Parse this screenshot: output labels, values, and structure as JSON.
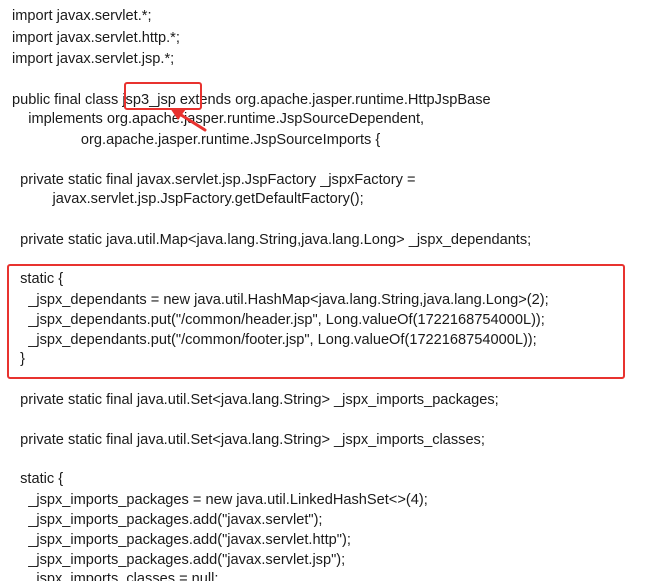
{
  "code_lines": [
    "import javax.servlet.*;",
    "import javax.servlet.http.*;",
    "import javax.servlet.jsp.*;",
    "public final class jsp3_jsp extends org.apache.jasper.runtime.HttpJspBase",
    "    implements org.apache.jasper.runtime.JspSourceDependent,",
    "                 org.apache.jasper.runtime.JspSourceImports {",
    "  private static final javax.servlet.jsp.JspFactory _jspxFactory =",
    "          javax.servlet.jsp.JspFactory.getDefaultFactory();",
    "  private static java.util.Map<java.lang.String,java.lang.Long> _jspx_dependants;",
    "  static {",
    "    _jspx_dependants = new java.util.HashMap<java.lang.String,java.lang.Long>(2);",
    "    _jspx_dependants.put(\"/common/header.jsp\", Long.valueOf(1722168754000L));",
    "    _jspx_dependants.put(\"/common/footer.jsp\", Long.valueOf(1722168754000L));",
    "  }",
    "  private static final java.util.Set<java.lang.String> _jspx_imports_packages;",
    "  private static final java.util.Set<java.lang.String> _jspx_imports_classes;",
    "  static {",
    "    _jspx_imports_packages = new java.util.LinkedHashSet<>(4);",
    "    _jspx_imports_packages.add(\"javax.servlet\");",
    "    _jspx_imports_packages.add(\"javax.servlet.http\");",
    "    _jspx_imports_packages.add(\"javax.servlet.jsp\");",
    "    _jspx_imports_classes = null;"
  ],
  "annotation_color": "#e8322f"
}
